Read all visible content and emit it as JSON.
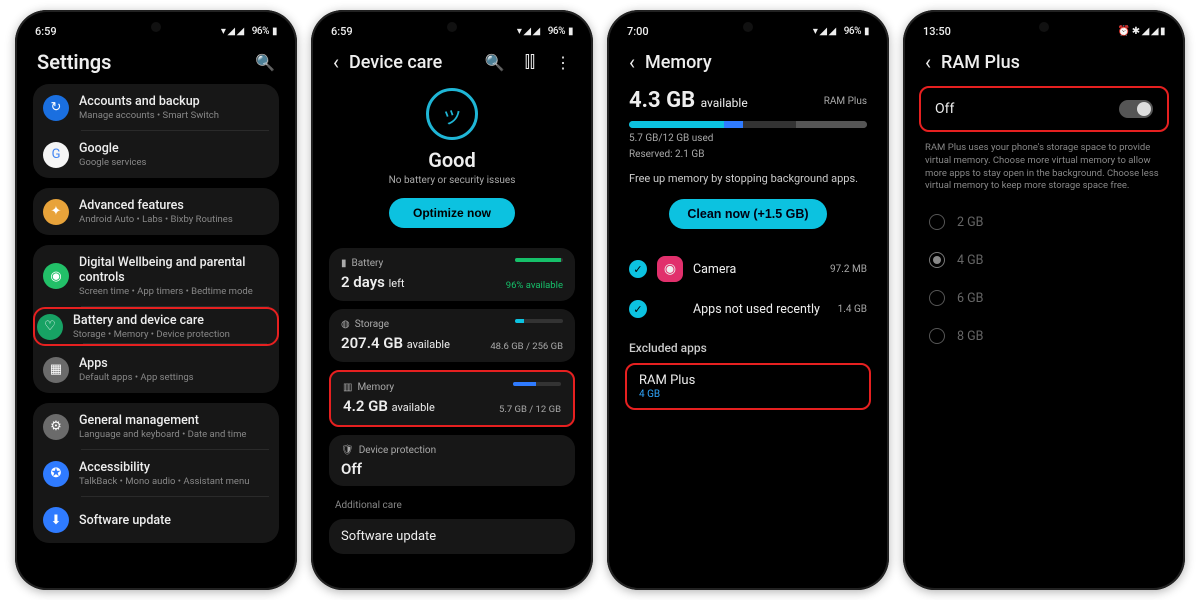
{
  "status": {
    "time1": "6:59",
    "time2": "6:59",
    "time3": "7:00",
    "time4": "13:50",
    "bat": "96%",
    "icons": "▾ ◢ ◢"
  },
  "s1": {
    "title": "Settings",
    "items": [
      {
        "label": "Accounts and backup",
        "sub": "Manage accounts  •  Smart Switch",
        "ico": "↻",
        "bg": "#1a6fe0"
      },
      {
        "label": "Google",
        "sub": "Google services",
        "ico": "G",
        "bg": "#f5f5f5",
        "fg": "#4285f4"
      },
      {
        "label": "Advanced features",
        "sub": "Android Auto  •  Labs  •  Bixby Routines",
        "ico": "✦",
        "bg": "#e8a33a"
      },
      {
        "label": "Digital Wellbeing and parental controls",
        "sub": "Screen time  •  App timers  •  Bedtime mode",
        "ico": "◉",
        "bg": "#22c068"
      },
      {
        "label": "Battery and device care",
        "sub": "Storage  •  Memory  •  Device protection",
        "ico": "♡",
        "bg": "#17a264",
        "hl": true
      },
      {
        "label": "Apps",
        "sub": "Default apps  •  App settings",
        "ico": "▦",
        "bg": "#6b6b6b"
      },
      {
        "label": "General management",
        "sub": "Language and keyboard  •  Date and time",
        "ico": "⚙",
        "bg": "#6b6b6b"
      },
      {
        "label": "Accessibility",
        "sub": "TalkBack  •  Mono audio  •  Assistant menu",
        "ico": "✪",
        "bg": "#2f7bff"
      },
      {
        "label": "Software update",
        "sub": "",
        "ico": "⬇",
        "bg": "#2f7bff"
      }
    ]
  },
  "s2": {
    "title": "Device care",
    "good": "Good",
    "sub": "No battery or security issues",
    "optimize": "Optimize now",
    "battery": {
      "label": "Battery",
      "val": "2 days",
      "suffix": "left",
      "pct": "96% available"
    },
    "storage": {
      "label": "Storage",
      "val": "207.4 GB",
      "suffix": "available",
      "right": "48.6 GB / 256 GB"
    },
    "memory": {
      "label": "Memory",
      "val": "4.2 GB",
      "suffix": "available",
      "right": "5.7 GB / 12 GB"
    },
    "devprot": {
      "label": "Device protection",
      "val": "Off"
    },
    "addl": "Additional care",
    "sw": "Software update"
  },
  "s3": {
    "title": "Memory",
    "big": "4.3 GB",
    "bigsuf": "available",
    "ramplus_badge": "RAM Plus",
    "used": "5.7 GB/12 GB used",
    "reserved": "Reserved: 2.1 GB",
    "hint": "Free up memory by stopping background apps.",
    "clean": "Clean now (+1.5 GB)",
    "apps": [
      {
        "name": "Camera",
        "size": "97.2 MB",
        "bg": "#e1306c",
        "ico": "◎"
      }
    ],
    "unused": "Apps not used recently",
    "unused_size": "1.4 GB",
    "excl": "Excluded apps",
    "ramplus": {
      "label": "RAM Plus",
      "val": "4 GB"
    }
  },
  "s4": {
    "title": "RAM Plus",
    "off": "Off",
    "desc": "RAM Plus uses your phone's storage space to provide virtual memory. Choose more virtual memory to allow more apps to stay open in the background. Choose less virtual memory to keep more storage space free.",
    "opts": [
      "2 GB",
      "4 GB",
      "6 GB",
      "8 GB"
    ],
    "selected": 1
  }
}
